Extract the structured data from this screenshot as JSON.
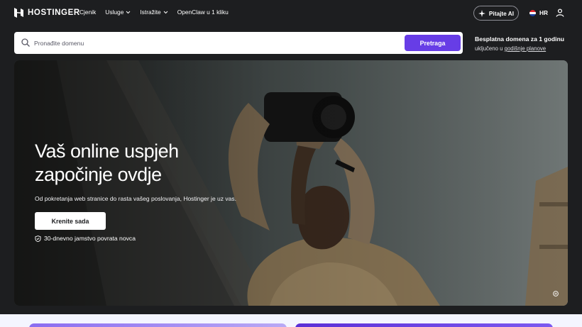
{
  "brand": {
    "name": "HOSTINGER",
    "logo_icon": "hostinger-logo-icon"
  },
  "nav": {
    "items": [
      {
        "label": "Cjenik",
        "has_dropdown": false
      },
      {
        "label": "Usluge",
        "has_dropdown": true
      },
      {
        "label": "Istražite",
        "has_dropdown": true
      },
      {
        "label": "OpenClaw u 1 kliku",
        "has_dropdown": false
      }
    ],
    "ai_button": "Pitajte AI",
    "language": "HR",
    "account_icon": "user-icon"
  },
  "search": {
    "placeholder": "Pronađite domenu",
    "button": "Pretraga"
  },
  "promo": {
    "title": "Besplatna domena za 1 godinu",
    "subtitle_prefix": "uključeno u ",
    "subtitle_link": "godišnje planove"
  },
  "hero": {
    "title_line1": "Vaš online uspjeh",
    "title_line2": "započinje ovdje",
    "subtitle": "Od pokretanja web stranice do rasta vašeg poslovanja, Hostinger je uz vas.",
    "cta": "Krenite sada",
    "guarantee": "30-dnevno jamstvo povrata novca"
  },
  "colors": {
    "background": "#1d1e20",
    "accent": "#673de6",
    "white": "#ffffff"
  }
}
